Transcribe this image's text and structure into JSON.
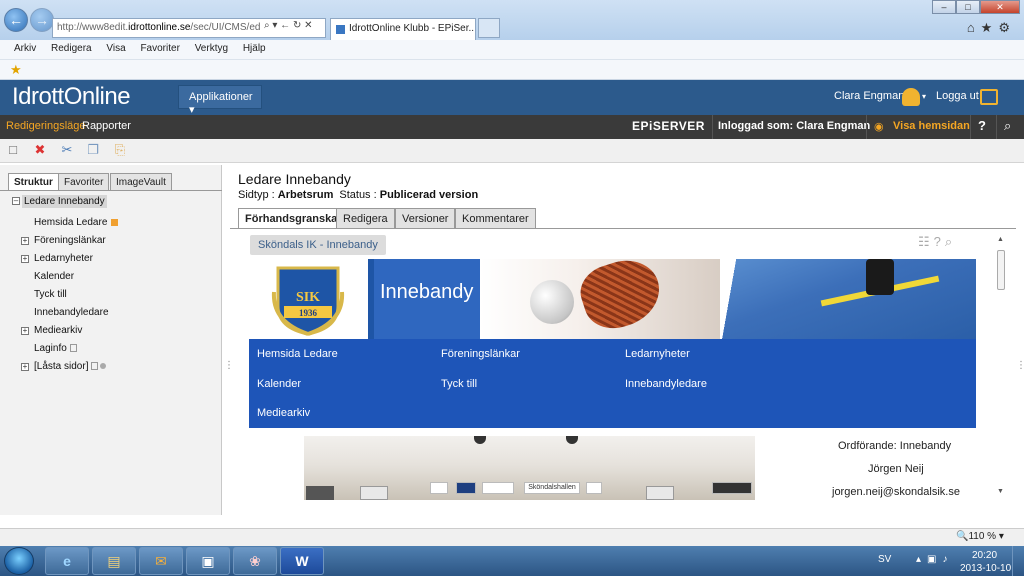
{
  "browser": {
    "url_prefix": "http://www8edit.",
    "url_domain": "idrottonline.se",
    "url_suffix": "/sec/UI/CMS/ed",
    "url_controls": "⌕ ▾ ← ↻ ✕",
    "tab_active": "IdrottOnline Klubb - EPiSer...",
    "window_controls": [
      "–",
      "□",
      "✕"
    ],
    "tools": "⌂★⚙"
  },
  "menu": [
    "Arkiv",
    "Redigera",
    "Visa",
    "Favoriter",
    "Verktyg",
    "Hjälp"
  ],
  "io_header": {
    "logo": "IdrottOnline",
    "applications": "Applikationer ▾",
    "user": "Clara Engman",
    "user_chev": "▾",
    "logout": "Logga ut"
  },
  "edit_bar": {
    "edit_mode": "Redigeringsläge",
    "reports": "Rapporter",
    "brand": "EPiSERVER",
    "logged_in": "Inloggad som: Clara Engman",
    "eye": "◉",
    "view_site": "Visa hemsidan",
    "help": "?",
    "search": "⌕"
  },
  "toolbar_icons": [
    "□",
    "✖",
    "✂",
    "❐",
    "⎘"
  ],
  "left_panel": {
    "tabs": [
      "Struktur",
      "Favoriter",
      "ImageVault"
    ],
    "root": "Ledare Innebandy",
    "tree": [
      {
        "label": "Hemsida Ledare"
      },
      {
        "label": "Föreningslänkar"
      },
      {
        "label": "Ledarnyheter"
      },
      {
        "label": "Kalender"
      },
      {
        "label": "Tyck till"
      },
      {
        "label": "Innebandyledare"
      },
      {
        "label": "Mediearkiv"
      },
      {
        "label": "Laginfo"
      },
      {
        "label": "[Låsta sidor]"
      }
    ]
  },
  "page": {
    "title": "Ledare Innebandy",
    "type_label": "Sidtyp : ",
    "type_value": "Arbetsrum",
    "status_label": "Status : ",
    "status_value": "Publicerad version",
    "tabs": [
      "Förhandsgranska",
      "Redigera",
      "Versioner",
      "Kommentarer"
    ]
  },
  "preview": {
    "badge": "Sköndals IK - Innebandy",
    "icons": "☷?⌕",
    "banner_title": "Innebandy",
    "crest_text": "SIK",
    "crest_year": "1936",
    "nav": [
      "Hemsida Ledare",
      "Föreningslänkar",
      "Ledarnyheter",
      "Kalender",
      "Tyck till",
      "Innebandyledare",
      "Mediearkiv"
    ],
    "hall_sign": "Sköndalshallen",
    "chair_title": "Ordförande: Innebandy",
    "chair_name": "Jörgen Neij",
    "chair_email": "jorgen.neij@skondalsik.se"
  },
  "status": {
    "zoom": "🔍110 % ▾"
  },
  "taskbar": {
    "apps": [
      "e",
      "▤",
      "✉",
      "▣",
      "❀",
      "W"
    ],
    "lang": "SV",
    "tray": "▴▣♪",
    "time": "20:20",
    "date": "2013-10-10"
  },
  "colors": {
    "header_blue": "#2c5a8c",
    "edit_bar": "#3a3a3a",
    "accent_orange": "#f5a623",
    "nav_blue": "#1e55b8"
  }
}
